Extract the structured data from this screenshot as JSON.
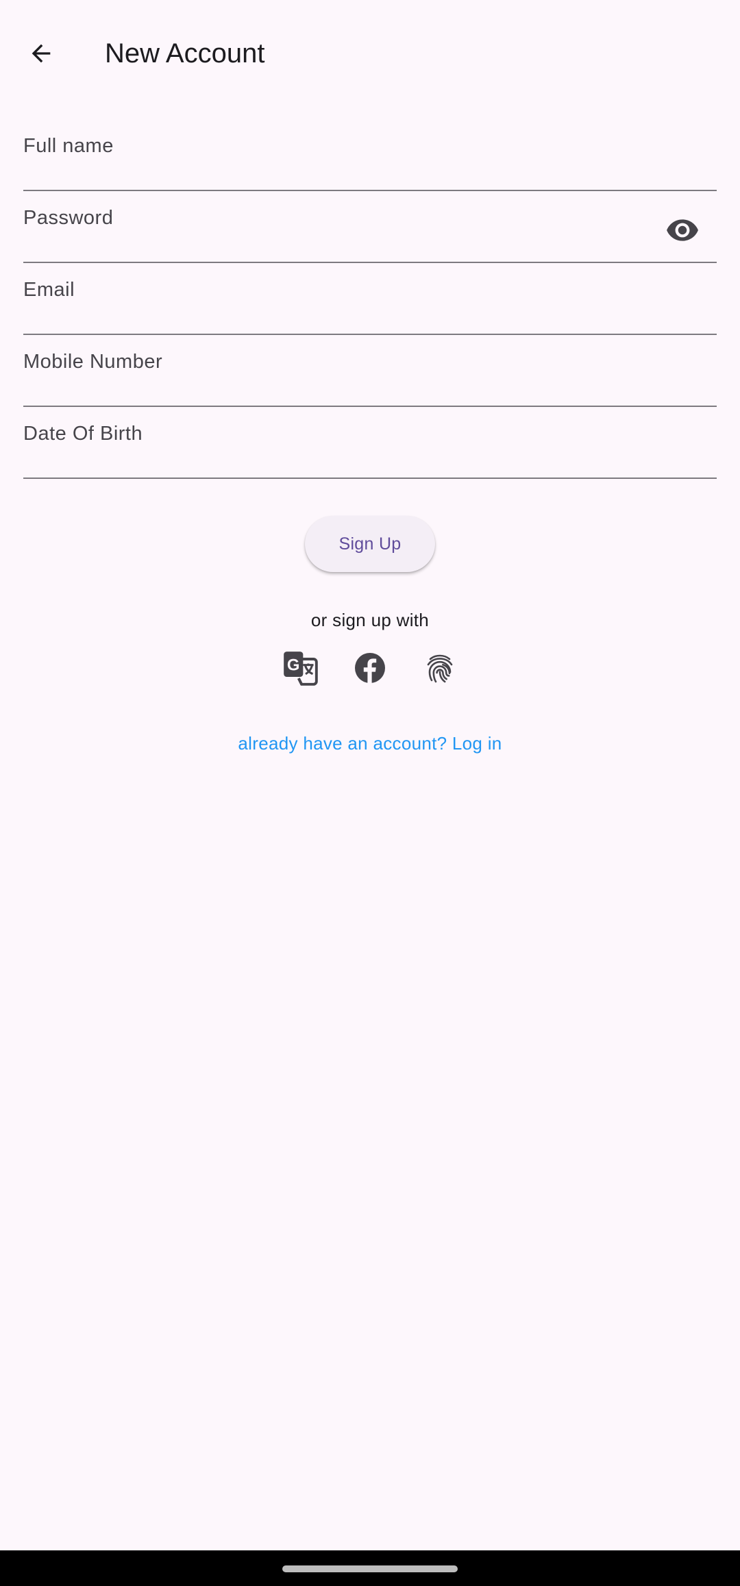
{
  "app_bar": {
    "title": "New Account",
    "back_icon": "arrow-back-icon"
  },
  "form": {
    "full_name": {
      "label": "Full name",
      "value": ""
    },
    "password": {
      "label": "Password",
      "value": "",
      "toggle_icon": "eye-icon"
    },
    "email": {
      "label": "Email",
      "value": ""
    },
    "mobile": {
      "label": "Mobile Number",
      "value": ""
    },
    "dob": {
      "label": "Date Of Birth",
      "value": ""
    }
  },
  "signup_button": {
    "label": "Sign Up"
  },
  "social": {
    "prompt": "or sign up with",
    "icons": [
      "google-translate-icon",
      "facebook-icon",
      "fingerprint-icon"
    ]
  },
  "login_link": {
    "label": "already have an account? Log in"
  },
  "colors": {
    "background": "#fdf7fc",
    "primary": "#5f4b9b",
    "link": "#2196f3",
    "icon": "#46444a",
    "underline": "#7d7a80"
  }
}
